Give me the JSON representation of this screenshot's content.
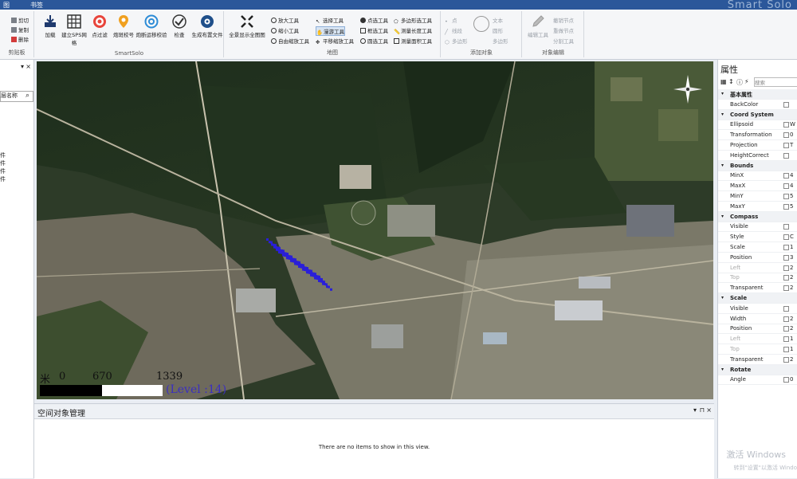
{
  "titlebar": {
    "tab_left": "图",
    "tab_mid": "书签",
    "brand": "Smart Solo"
  },
  "ribbon": {
    "clipboard": {
      "label": "剪贴板",
      "items": [
        "剪切",
        "复制",
        "删除"
      ]
    },
    "smartsolo": {
      "label": "SmartSolo",
      "buttons": [
        "加载",
        "建立SPS网格",
        "点过滤",
        "炮斑校号",
        "炮断运移校验",
        "检查",
        "生成布置文件"
      ]
    },
    "map": {
      "label": "地图",
      "big_button": "全景显示全图图",
      "col1": [
        "放大工具",
        "缩小工具",
        "自由缩放工具"
      ],
      "col2": [
        "选择工具",
        "漫游工具",
        "平移缩放工具"
      ],
      "col3": [
        "点选工具",
        "框选工具",
        "圆选工具"
      ],
      "col4": [
        "多边形选工具",
        "测量长度工具",
        "测量面积工具"
      ]
    },
    "add_object": {
      "label": "添加对象",
      "items": [
        "点",
        "线段",
        "多边形"
      ],
      "extra": [
        "文本",
        "圆形",
        "矩形",
        "多边形"
      ]
    },
    "object_edit": {
      "label": "对象编辑",
      "big_button": "编辑工具",
      "items": [
        "撤销节点",
        "重做节点",
        "分割工具"
      ]
    }
  },
  "left_panel": {
    "search_placeholder": "层名称",
    "tree_items": [
      "件",
      "件",
      "件",
      "件"
    ]
  },
  "map": {
    "scale_labels": [
      "0",
      "670",
      "1339"
    ],
    "scale_prefix": "米",
    "level_text": "(Level :14)"
  },
  "bottom_panel": {
    "title": "空间对象管理",
    "empty_text": "There are no items to show in this view."
  },
  "properties": {
    "title": "属性",
    "search_placeholder": "搜索",
    "rows": [
      {
        "type": "cat",
        "name": "基本属性"
      },
      {
        "type": "prop",
        "name": "BackColor",
        "value": ""
      },
      {
        "type": "cat",
        "name": "Coord System"
      },
      {
        "type": "prop",
        "name": "Ellipsoid",
        "value": "W"
      },
      {
        "type": "prop",
        "name": "Transformation",
        "value": "0"
      },
      {
        "type": "prop",
        "name": "Projection",
        "value": "T"
      },
      {
        "type": "prop",
        "name": "HeightCorrect",
        "value": ""
      },
      {
        "type": "cat",
        "name": "Bounds"
      },
      {
        "type": "prop",
        "name": "MinX",
        "value": "4"
      },
      {
        "type": "prop",
        "name": "MaxX",
        "value": "4"
      },
      {
        "type": "prop",
        "name": "MinY",
        "value": "5"
      },
      {
        "type": "prop",
        "name": "MaxY",
        "value": "5"
      },
      {
        "type": "cat",
        "name": "Compass"
      },
      {
        "type": "prop",
        "name": "Visible",
        "value": ""
      },
      {
        "type": "prop",
        "name": "Style",
        "value": "C"
      },
      {
        "type": "prop",
        "name": "Scale",
        "value": "1"
      },
      {
        "type": "prop",
        "name": "Position",
        "value": "3"
      },
      {
        "type": "prop",
        "name": "Left",
        "value": "2",
        "disabled": true
      },
      {
        "type": "prop",
        "name": "Top",
        "value": "2",
        "disabled": true
      },
      {
        "type": "prop",
        "name": "Transparent",
        "value": "2"
      },
      {
        "type": "cat",
        "name": "Scale"
      },
      {
        "type": "prop",
        "name": "Visible",
        "value": ""
      },
      {
        "type": "prop",
        "name": "Width",
        "value": "2"
      },
      {
        "type": "prop",
        "name": "Position",
        "value": "2"
      },
      {
        "type": "prop",
        "name": "Left",
        "value": "1",
        "disabled": true
      },
      {
        "type": "prop",
        "name": "Top",
        "value": "1",
        "disabled": true
      },
      {
        "type": "prop",
        "name": "Transparent",
        "value": "2"
      },
      {
        "type": "cat",
        "name": "Rotate"
      },
      {
        "type": "prop",
        "name": "Angle",
        "value": "0"
      }
    ]
  },
  "watermark": {
    "line1": "激活 Windows",
    "line2": "转到\"设置\"以激活 Windo"
  },
  "colors": {
    "ribbon_blue": "#2b579a",
    "selection_points": "#2a1fd8",
    "level_text": "#3b2fbf"
  }
}
